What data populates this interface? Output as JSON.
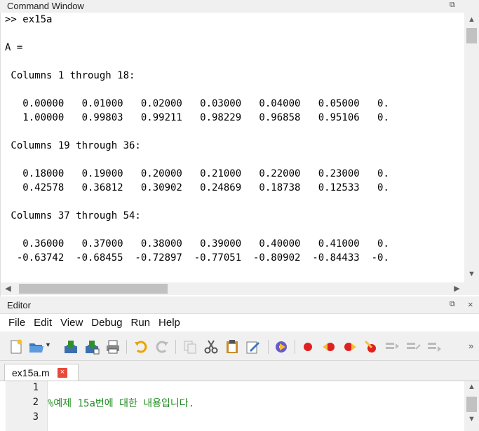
{
  "command_window": {
    "title": "Command Window",
    "restore_icon": "⧉",
    "lines": [
      ">> ex15a",
      "",
      "A =",
      "",
      " Columns 1 through 18:",
      "",
      "   0.00000   0.01000   0.02000   0.03000   0.04000   0.05000   0.",
      "   1.00000   0.99803   0.99211   0.98229   0.96858   0.95106   0.",
      "",
      " Columns 19 through 36:",
      "",
      "   0.18000   0.19000   0.20000   0.21000   0.22000   0.23000   0.",
      "   0.42578   0.36812   0.30902   0.24869   0.18738   0.12533   0.",
      "",
      " Columns 37 through 54:",
      "",
      "   0.36000   0.37000   0.38000   0.39000   0.40000   0.41000   0.",
      "  -0.63742  -0.68455  -0.72897  -0.77051  -0.80902  -0.84433  -0."
    ]
  },
  "editor": {
    "title": "Editor",
    "restore_icon": "⧉",
    "close_icon": "×",
    "menu": [
      "File",
      "Edit",
      "View",
      "Debug",
      "Run",
      "Help"
    ],
    "toolbar_overflow": "»",
    "tab": {
      "label": "ex15a.m",
      "close": "×"
    },
    "line_numbers": [
      "1",
      "2",
      "3"
    ],
    "code_line_2": "%예제 15a번에 대한 내용입니다.",
    "colors": {
      "comment": "#228b22",
      "tab_close": "#e64a3c",
      "record": "#e02020"
    }
  }
}
